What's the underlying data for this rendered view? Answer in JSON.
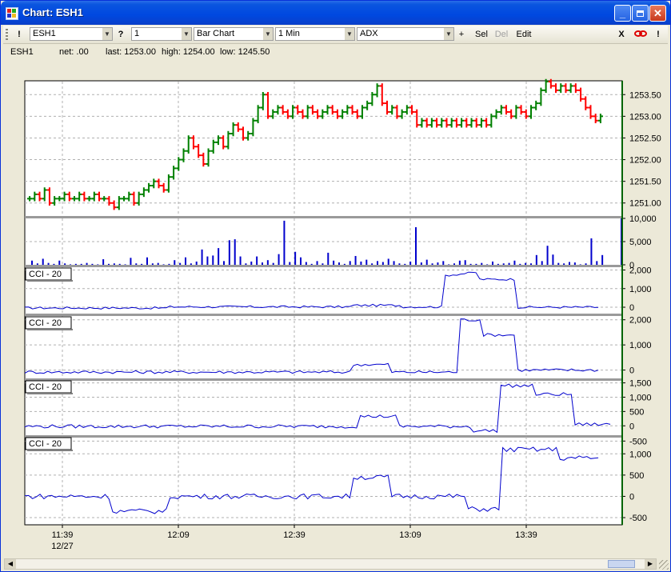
{
  "window": {
    "title": "Chart: ESH1"
  },
  "toolbar": {
    "bang": "!",
    "symbol": "ESH1",
    "help": "?",
    "interval_count": "1",
    "chart_type": "Bar Chart",
    "period": "1 Min",
    "indicator": "ADX",
    "add": "+",
    "select": "Sel",
    "delete": "Del",
    "edit": "Edit",
    "close_x": "X",
    "bang2": "!"
  },
  "info": {
    "symbol": "ESH1",
    "net": "net: .00",
    "last": "last: 1253.00",
    "high": "high: 1254.00",
    "low": "low: 1245.50"
  },
  "colors": {
    "up": "#008000",
    "down": "#ff0000",
    "volume": "#0000cd",
    "cci": "#0000cd",
    "grid": "#b0b0b0"
  },
  "chart_data": {
    "type": "bar",
    "x_tick_labels": [
      "11:39",
      "12:09",
      "12:39",
      "13:09",
      "13:39"
    ],
    "x_date_label": "12/27",
    "price_ticks": [
      "1253.50",
      "1253.00",
      "1252.50",
      "1252.00",
      "1251.50",
      "1251.00"
    ],
    "price_range": [
      1250.7,
      1253.8
    ],
    "volume_ticks": [
      "10,000",
      "5,000",
      "0"
    ],
    "volume_range": [
      0,
      10000
    ],
    "panels": [
      {
        "label": "CCI - 20",
        "ticks": [
          "2,000",
          "1,000",
          "0"
        ],
        "tick_values": [
          2000,
          1000,
          0
        ],
        "range": [
          -300,
          2150
        ]
      },
      {
        "label": "CCI - 20",
        "ticks": [
          "2,000",
          "1,000",
          "0"
        ],
        "tick_values": [
          2000,
          1000,
          0
        ],
        "range": [
          -300,
          2150
        ]
      },
      {
        "label": "CCI - 20",
        "ticks": [
          "1,500",
          "1,000",
          "500",
          "0"
        ],
        "tick_values": [
          1500,
          1000,
          500,
          0
        ],
        "range": [
          -300,
          1600
        ]
      },
      {
        "label": "CCI - 20",
        "ticks": [
          "-500",
          "1,000",
          "500",
          "0",
          "-500"
        ],
        "tick_values": [
          1300,
          1000,
          500,
          0,
          -500
        ],
        "range": [
          -650,
          1400
        ]
      }
    ],
    "price_ohlc_step_values": [
      1251.1,
      1251.2,
      1251.1,
      1251.3,
      1251.0,
      1251.1,
      1251.1,
      1251.2,
      1251.1,
      1251.1,
      1251.2,
      1251.1,
      1251.1,
      1251.2,
      1251.1,
      1251.1,
      1251.0,
      1250.9,
      1251.1,
      1251.1,
      1251.2,
      1251.0,
      1251.2,
      1251.3,
      1251.4,
      1251.5,
      1251.4,
      1251.3,
      1251.6,
      1251.8,
      1252.0,
      1252.2,
      1252.5,
      1252.3,
      1252.1,
      1251.9,
      1252.2,
      1252.4,
      1252.5,
      1252.3,
      1252.6,
      1252.8,
      1252.7,
      1252.5,
      1252.6,
      1252.9,
      1253.2,
      1253.5,
      1253.0,
      1253.1,
      1253.2,
      1253.1,
      1253.0,
      1253.2,
      1253.1,
      1253.0,
      1253.2,
      1253.1,
      1253.0,
      1253.1,
      1253.2,
      1253.1,
      1253.0,
      1253.1,
      1253.2,
      1253.1,
      1253.0,
      1253.2,
      1253.3,
      1253.5,
      1253.7,
      1253.3,
      1253.1,
      1253.2,
      1253.0,
      1253.1,
      1253.2,
      1253.1,
      1252.8,
      1252.9,
      1252.8,
      1252.9,
      1252.8,
      1252.9,
      1252.8,
      1252.9,
      1252.8,
      1252.9,
      1252.8,
      1252.9,
      1252.8,
      1252.9,
      1252.8,
      1253.0,
      1253.1,
      1253.2,
      1253.1,
      1253.0,
      1253.2,
      1253.1,
      1253.0,
      1253.2,
      1253.3,
      1253.6,
      1253.8,
      1253.7,
      1253.6,
      1253.7,
      1253.6,
      1253.7,
      1253.6,
      1253.4,
      1253.2,
      1253.0,
      1252.9,
      1253.0
    ],
    "volume_values": [
      900,
      300,
      1300,
      400,
      200,
      900,
      300,
      100,
      200,
      200,
      400,
      200,
      100,
      1200,
      200,
      300,
      200,
      100,
      1500,
      300,
      200,
      1600,
      300,
      400,
      100,
      200,
      1000,
      400,
      1600,
      300,
      700,
      3300,
      1800,
      2000,
      3600,
      800,
      5300,
      5500,
      1800,
      300,
      700,
      1800,
      500,
      1000,
      400,
      2300,
      9500,
      600,
      2800,
      1600,
      600,
      200,
      800,
      300,
      2600,
      900,
      500,
      200,
      800,
      1900,
      700,
      1100,
      300,
      800,
      600,
      1300,
      800,
      300,
      200,
      700,
      8100,
      500,
      1100,
      300,
      500,
      800,
      100,
      300,
      900,
      1000,
      200,
      200,
      400,
      100,
      700,
      200,
      300,
      400,
      900,
      200,
      400,
      300,
      2100,
      800,
      4100,
      2200,
      400,
      300,
      600,
      500,
      100,
      300,
      5700,
      800,
      2100
    ]
  }
}
